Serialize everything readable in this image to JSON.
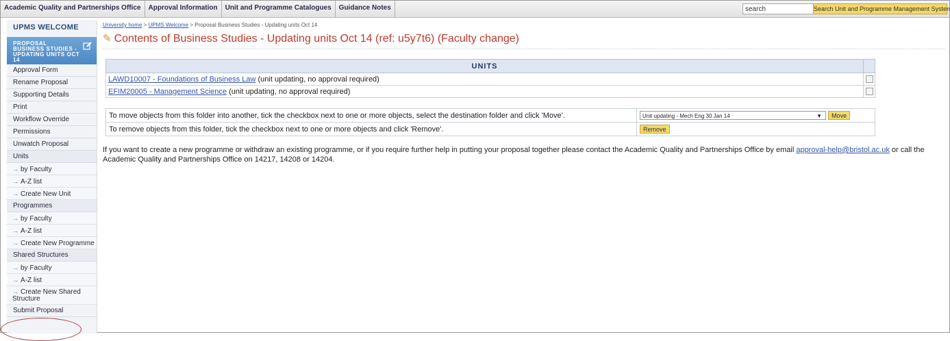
{
  "topnav": {
    "items": [
      "Academic Quality and Partnerships Office",
      "Approval Information",
      "Unit and Programme Catalogues",
      "Guidance Notes"
    ],
    "search_value": "search",
    "search_button": "Search Unit and Programme Management System"
  },
  "sidebar": {
    "title": "UPMS WELCOME",
    "proposal": "PROPOSAL BUSINESS STUDIES - UPDATING UNITS OCT 14",
    "items": [
      {
        "label": "Approval Form"
      },
      {
        "label": "Rename Proposal"
      },
      {
        "label": "Supporting Details"
      },
      {
        "label": "Print"
      },
      {
        "label": "Workflow Override"
      },
      {
        "label": "Permissions"
      },
      {
        "label": "Unwatch Proposal"
      },
      {
        "label": "Units"
      },
      {
        "label": "by Faculty"
      },
      {
        "label": "A-Z list"
      },
      {
        "label": "Create New Unit"
      },
      {
        "label": "Programmes"
      },
      {
        "label": "by Faculty"
      },
      {
        "label": "A-Z list"
      },
      {
        "label": "Create New Programme"
      },
      {
        "label": "Shared Structures"
      },
      {
        "label": "by Faculty"
      },
      {
        "label": "A-Z list"
      },
      {
        "label": "Create New Shared Structure"
      },
      {
        "label": "Submit Proposal"
      }
    ]
  },
  "breadcrumb": {
    "home": "University home",
    "welcome": "UPMS Welcome",
    "current": "Proposal Business Studies - Updating units Oct 14",
    "separator": ">"
  },
  "page_title": "Contents of Business Studies - Updating units Oct 14 (ref: u5y7t6) (Faculty change)",
  "units": {
    "header": "UNITS",
    "rows": [
      {
        "link": "LAWD10007 - Foundations of Business Law",
        "note": "(unit updating, no approval required)"
      },
      {
        "link": "EFIM20005 - Management Science",
        "note": "(unit updating, no approval required)"
      }
    ]
  },
  "actions": {
    "move_text": "To move objects from this folder into another, tick the checkbox next to one or more objects, select the destination folder and click 'Move'.",
    "move_select": "Unit updating - Mech Eng 30 Jan 14",
    "move_button": "Move",
    "remove_text": "To remove objects from this folder, tick the checkbox next to one or more objects and click 'Remove'.",
    "remove_button": "Remove"
  },
  "help": {
    "text1": "If you want to create a new programme or withdraw an existing programme, or if you require further help in putting your proposal together please contact the Academic Quality and Partnerships Office by email ",
    "email": "approval-help@bristol.ac.uk",
    "text2": " or call the Academic Quality and Partnerships Office on 14217, 14208 or 14204."
  },
  "colors": {
    "title": "#c0392b",
    "link": "#3355aa",
    "button": "#f4d86a",
    "sidebar_highlight": "#4d87c4"
  }
}
